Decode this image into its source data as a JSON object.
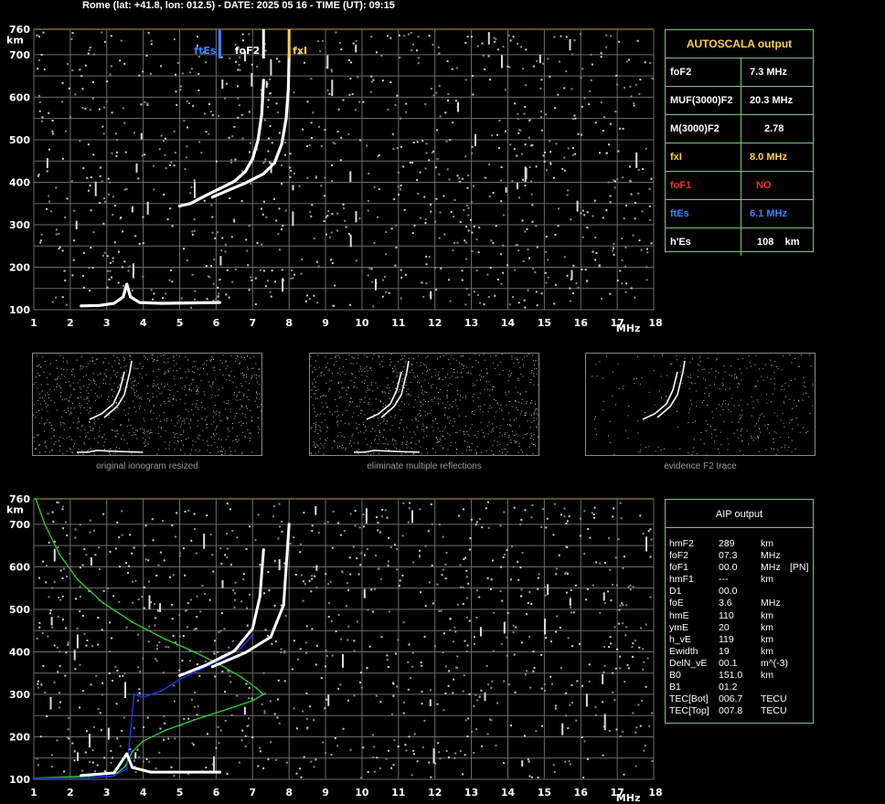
{
  "header": "Rome (lat: +41.8, lon: 012.5) - DATE: 2025 05 16 - TIME (UT): 09:15",
  "colors": {
    "grid": "#6b6b6b",
    "frame": "#b8a640",
    "yellow": "#ffd24a",
    "blue": "#3a86ff",
    "red": "#ff2a2a",
    "green": "#7ec37e",
    "trace": "#ffffff",
    "profile_green": "#2fd12f",
    "profile_blue": "#1c3cff"
  },
  "chart_data": [
    {
      "type": "scatter",
      "title": "",
      "xlabel": "MHz",
      "ylabel": "km",
      "xlim": [
        1,
        18
      ],
      "ylim": [
        100,
        760
      ],
      "x_ticks": [
        "1",
        "2",
        "3",
        "4",
        "5",
        "6",
        "7",
        "8",
        "9",
        "10",
        "11",
        "12",
        "13",
        "14",
        "15",
        "16",
        "17",
        "18"
      ],
      "y_ticks": [
        "100",
        "200",
        "300",
        "400",
        "500",
        "600",
        "700",
        "760"
      ],
      "grid": true,
      "markers": [
        {
          "label": "ftEs",
          "x": 6.1,
          "color": "#3a86ff"
        },
        {
          "label": "foF2",
          "x": 7.3,
          "color": "#ffffff"
        },
        {
          "label": "fxI",
          "x": 8.0,
          "color": "#ffd24a"
        }
      ],
      "series": [
        {
          "points": [
            [
              2.3,
              109
            ],
            [
              2.8,
              110
            ],
            [
              3.2,
              115
            ],
            [
              3.45,
              130
            ],
            [
              3.55,
              160
            ],
            [
              3.65,
              130
            ],
            [
              3.9,
              117
            ],
            [
              4.5,
              115
            ],
            [
              5.2,
              116
            ],
            [
              6.1,
              117
            ]
          ]
        },
        {
          "points": [
            [
              5.0,
              344
            ],
            [
              5.3,
              350
            ],
            [
              5.7,
              368
            ],
            [
              6.1,
              385
            ],
            [
              6.5,
              402
            ],
            [
              6.8,
              425
            ],
            [
              7.0,
              455
            ],
            [
              7.15,
              500
            ],
            [
              7.25,
              560
            ],
            [
              7.3,
              640
            ]
          ]
        },
        {
          "points": [
            [
              5.9,
              365
            ],
            [
              6.3,
              380
            ],
            [
              6.8,
              398
            ],
            [
              7.3,
              420
            ],
            [
              7.6,
              445
            ],
            [
              7.8,
              490
            ],
            [
              7.92,
              550
            ],
            [
              7.98,
              620
            ],
            [
              8.0,
              700
            ]
          ]
        }
      ]
    },
    {
      "type": "line",
      "title": "",
      "xlabel": "MHz",
      "ylabel": "km",
      "xlim": [
        1,
        18
      ],
      "ylim": [
        100,
        760
      ],
      "x_ticks": [
        "1",
        "2",
        "3",
        "4",
        "5",
        "6",
        "7",
        "8",
        "9",
        "10",
        "11",
        "12",
        "13",
        "14",
        "15",
        "16",
        "17",
        "18"
      ],
      "y_ticks": [
        "100",
        "200",
        "300",
        "400",
        "500",
        "600",
        "700",
        "760"
      ],
      "grid": true,
      "series": [
        {
          "points": [
            [
              1.05,
              760
            ],
            [
              1.3,
              700
            ],
            [
              1.7,
              630
            ],
            [
              2.2,
              570
            ],
            [
              2.9,
              515
            ],
            [
              3.7,
              470
            ],
            [
              4.6,
              430
            ],
            [
              5.4,
              400
            ],
            [
              6.1,
              370
            ],
            [
              6.7,
              340
            ],
            [
              7.1,
              315
            ],
            [
              7.3,
              300
            ],
            [
              7.0,
              285
            ],
            [
              6.3,
              265
            ],
            [
              5.4,
              240
            ],
            [
              4.6,
              215
            ],
            [
              4.0,
              190
            ],
            [
              3.7,
              165
            ],
            [
              3.5,
              130
            ],
            [
              3.3,
              115
            ],
            [
              2.5,
              108
            ],
            [
              1.0,
              103
            ]
          ]
        },
        {
          "points": [
            [
              1.0,
              103
            ],
            [
              2.5,
              104
            ],
            [
              3.2,
              108
            ],
            [
              3.55,
              125
            ],
            [
              3.75,
              300
            ],
            [
              4.0,
              293
            ],
            [
              4.5,
              308
            ],
            [
              5.0,
              335
            ],
            [
              5.6,
              360
            ],
            [
              6.2,
              385
            ],
            [
              6.7,
              410
            ],
            [
              7.0,
              440
            ]
          ]
        },
        {
          "points": [
            [
              2.3,
              109
            ],
            [
              3.2,
              115
            ],
            [
              3.55,
              160
            ],
            [
              3.7,
              128
            ],
            [
              4.2,
              117
            ],
            [
              6.1,
              117
            ]
          ]
        },
        {
          "points": [
            [
              5.0,
              344
            ],
            [
              5.7,
              368
            ],
            [
              6.5,
              402
            ],
            [
              7.0,
              455
            ],
            [
              7.2,
              530
            ],
            [
              7.3,
              640
            ]
          ]
        },
        {
          "points": [
            [
              5.9,
              365
            ],
            [
              6.8,
              398
            ],
            [
              7.5,
              435
            ],
            [
              7.85,
              510
            ],
            [
              8.0,
              700
            ]
          ]
        }
      ]
    }
  ],
  "autoscala": {
    "title": "AUTOSCALA output",
    "rows": [
      {
        "label": "foF2",
        "value": "7.3 MHz",
        "color": "#ffffff"
      },
      {
        "label": "MUF(3000)F2",
        "value": "20.3 MHz",
        "color": "#ffffff"
      },
      {
        "label": "M(3000)F2",
        "value": "2.78",
        "color": "#ffffff"
      },
      {
        "label": "fxI",
        "value": "8.0 MHz",
        "color": "#ffd24a"
      },
      {
        "label": "foF1",
        "value": "NO",
        "color": "#ff2a2a"
      },
      {
        "label": "ftEs",
        "value": "6.1 MHz",
        "color": "#3a86ff"
      },
      {
        "label": "h'Es",
        "value": "108    km",
        "color": "#ffffff"
      }
    ]
  },
  "thumbs": [
    {
      "caption": "original ionogram resized"
    },
    {
      "caption": "eliminate multiple reflections"
    },
    {
      "caption": "evidence F2 trace"
    }
  ],
  "aip": {
    "title": "AIP output",
    "rows": [
      {
        "k": "hmF2",
        "v": "289",
        "u": "km",
        "x": ""
      },
      {
        "k": "foF2",
        "v": "07.3",
        "u": "MHz",
        "x": ""
      },
      {
        "k": "foF1",
        "v": "00.0",
        "u": "MHz",
        "x": "[PN]"
      },
      {
        "k": "hmF1",
        "v": "---",
        "u": "km",
        "x": ""
      },
      {
        "k": "D1",
        "v": "00.0",
        "u": "",
        "x": ""
      },
      {
        "k": "foE",
        "v": "3.6",
        "u": "MHz",
        "x": ""
      },
      {
        "k": "hmE",
        "v": "110",
        "u": "km",
        "x": ""
      },
      {
        "k": "ymE",
        "v": "20",
        "u": "km",
        "x": ""
      },
      {
        "k": "h_vE",
        "v": "119",
        "u": "km",
        "x": ""
      },
      {
        "k": "Ewidth",
        "v": "19",
        "u": "km",
        "x": ""
      },
      {
        "k": "DelN_vE",
        "v": "00.1",
        "u": "m^(-3)",
        "x": ""
      },
      {
        "k": "B0",
        "v": "151.0",
        "u": "km",
        "x": ""
      },
      {
        "k": "B1",
        "v": "01.2",
        "u": "",
        "x": ""
      },
      {
        "k": "TEC[Bot]",
        "v": "006.7",
        "u": "TECU",
        "x": ""
      },
      {
        "k": "TEC[Top]",
        "v": "007.8",
        "u": "TECU",
        "x": ""
      }
    ]
  }
}
